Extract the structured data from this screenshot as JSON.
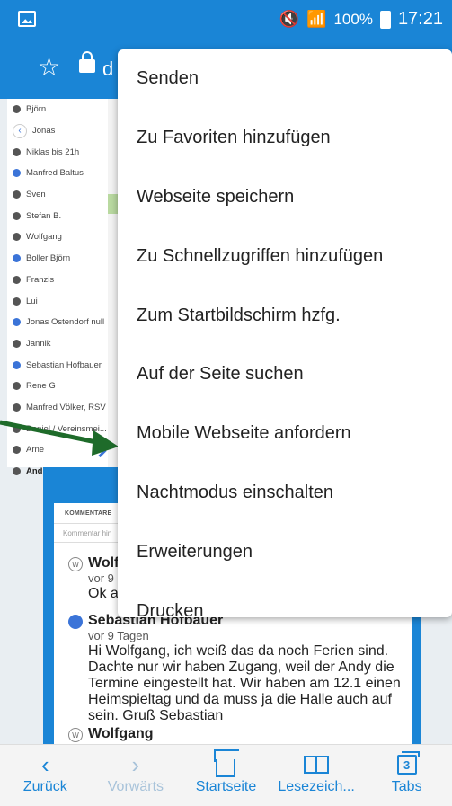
{
  "status_bar": {
    "battery": "100%",
    "time": "17:21"
  },
  "url_bar": {
    "url_fragment": "d"
  },
  "contacts": [
    {
      "name": "Björn",
      "icon": "person-icon"
    },
    {
      "name": "Jonas",
      "icon": "person-icon"
    },
    {
      "name": "Niklas bis 21h",
      "icon": "person-icon"
    },
    {
      "name": "Manfred Baltus",
      "icon": "avatar-icon"
    },
    {
      "name": "Sven",
      "icon": "person-icon"
    },
    {
      "name": "Stefan B.",
      "icon": "person-icon"
    },
    {
      "name": "Wolfgang",
      "icon": "person-icon"
    },
    {
      "name": "Boller Björn",
      "icon": "avatar-icon"
    },
    {
      "name": "Franzis",
      "icon": "person-icon"
    },
    {
      "name": "Lui",
      "icon": "person-icon"
    },
    {
      "name": "Jonas Ostendorf null",
      "icon": "avatar-icon"
    },
    {
      "name": "Jannik",
      "icon": "person-icon"
    },
    {
      "name": "Sebastian Hofbauer",
      "icon": "avatar-icon"
    },
    {
      "name": "Rene G",
      "icon": "person-icon"
    },
    {
      "name": "Manfred Völker, RSV",
      "icon": "person-icon"
    },
    {
      "name": "Daniel / Vereinsmei...",
      "icon": "person-icon"
    },
    {
      "name": "Arne",
      "icon": "person-icon"
    },
    {
      "name": "Andreas",
      "icon": "person-icon"
    }
  ],
  "comments_section": {
    "heading": "KOMMENTARE",
    "input_placeholder": "Kommentar hin",
    "comments": [
      {
        "avatar": "W",
        "name": "Wolf",
        "ago": "vor 9",
        "text": "Ok a"
      },
      {
        "avatar": "",
        "name": "Sebastian Hofbauer",
        "ago": "vor 9 Tagen",
        "text": "Hi Wolfgang, ich weiß das da noch Ferien sind. Dachte nur wir haben Zugang, weil der Andy die Termine eingestellt hat. Wir haben am 12.1 einen Heimspieltag und da muss ja die Halle auch auf sein. Gruß Sebastian"
      },
      {
        "avatar": "W",
        "name": "Wolfgang",
        "ago": "",
        "text": ""
      }
    ]
  },
  "menu": {
    "items": [
      "Senden",
      "Zu Favoriten hinzufügen",
      "Webseite speichern",
      "Zu Schnellzugriffen hinzufügen",
      "Zum Startbildschirm hzfg.",
      "Auf der Seite suchen",
      "Mobile Webseite anfordern",
      "Nachtmodus einschalten",
      "Erweiterungen",
      "Drucken"
    ]
  },
  "bottom_nav": {
    "back": "Zurück",
    "forward": "Vorwärts",
    "home": "Startseite",
    "bookmarks": "Lesezeich...",
    "tabs": "Tabs",
    "tab_count": "3"
  },
  "colors": {
    "brand_blue": "#1a85d6",
    "arrow_green": "#1e6b2a"
  }
}
